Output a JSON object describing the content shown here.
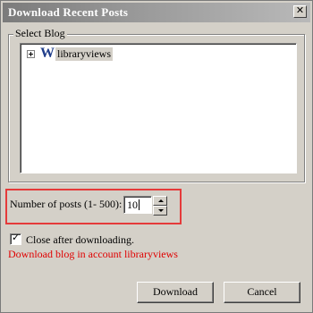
{
  "dialog": {
    "title": "Download Recent Posts",
    "close_glyph": "✕",
    "close_icon": "close-icon"
  },
  "select_blog": {
    "group_label": "Select Blog",
    "tree": {
      "expander_icon": "plus-expander-icon",
      "blog_icon": "wordpress-icon",
      "blog_icon_glyph": "W",
      "items": [
        {
          "label": "libraryviews",
          "selected": true
        }
      ]
    }
  },
  "posts": {
    "label": "Number of posts (1- 500):",
    "value": "10",
    "highlight_color": "#e53a3a"
  },
  "options": {
    "close_after_label": "Close after downloading.",
    "close_after_checked": true,
    "check_glyph": "✓",
    "info_text": "Download blog in account libraryviews",
    "info_color": "#e00000"
  },
  "buttons": {
    "download_label": "Download",
    "cancel_label": "Cancel"
  }
}
